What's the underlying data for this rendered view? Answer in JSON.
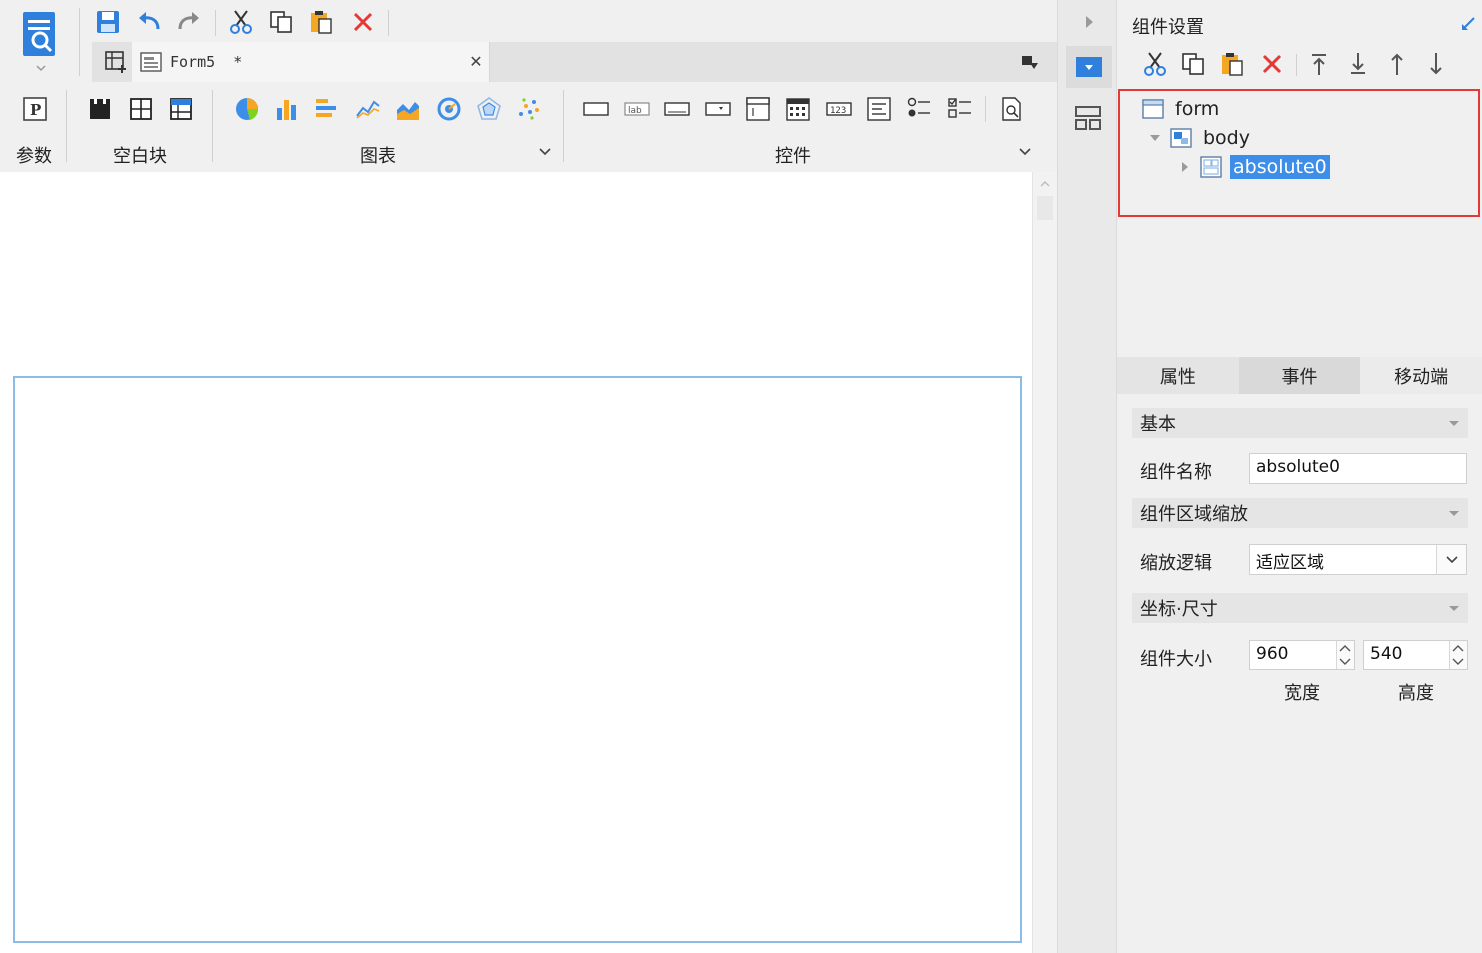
{
  "colors": {
    "accent": "#3d8ee8",
    "highlight_border": "#e53935",
    "canvas_frame": "#8dbbe8",
    "delete_red": "#e53935"
  },
  "toolbar": {
    "quick_access": [
      {
        "name": "save-icon"
      },
      {
        "name": "undo-icon"
      },
      {
        "name": "redo-icon"
      },
      {
        "name": "cut-icon"
      },
      {
        "name": "copy-icon"
      },
      {
        "name": "paste-icon"
      },
      {
        "name": "delete-icon"
      }
    ]
  },
  "editor_tab": {
    "label": "Form5  *",
    "close_symbol": "✕"
  },
  "ribbon": {
    "params_label": "参数",
    "blank_block_label": "空白块",
    "chart_label": "图表",
    "controls_label": "控件"
  },
  "right_panel": {
    "title": "组件设置",
    "tree": {
      "root": "form",
      "child": "body",
      "grandchild": "absolute0"
    },
    "tabs": [
      "属性",
      "事件",
      "移动端"
    ],
    "sections": {
      "basic": "基本",
      "scale": "组件区域缩放",
      "coords": "坐标·尺寸"
    },
    "fields": {
      "name_label": "组件名称",
      "name_value": "absolute0",
      "scale_label": "缩放逻辑",
      "scale_value": "适应区域",
      "size_label": "组件大小",
      "width_value": "960",
      "height_value": "540",
      "width_caption": "宽度",
      "height_caption": "高度"
    }
  }
}
